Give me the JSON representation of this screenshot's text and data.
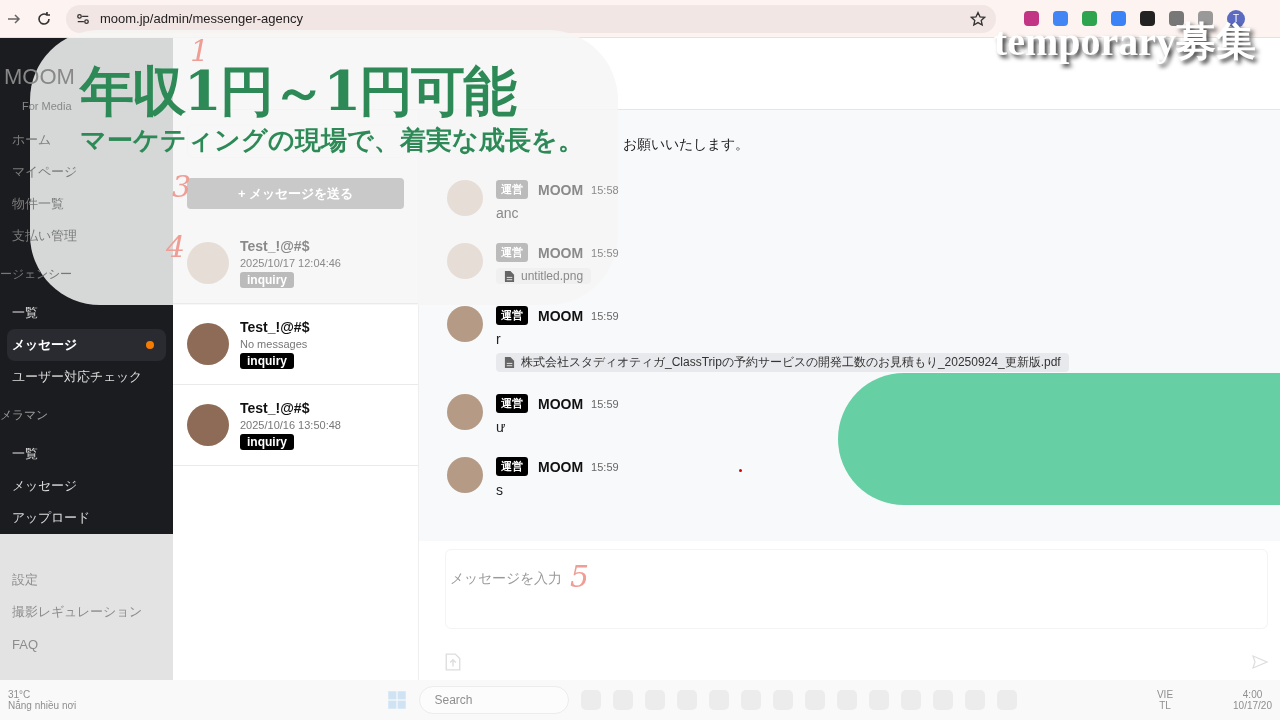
{
  "browser": {
    "url": "moom.jp/admin/messenger-agency",
    "profile": "T"
  },
  "sidebar": {
    "logo": "MOOM",
    "subtitle": "For Media",
    "sections": [
      {
        "faded": false,
        "items": [
          {
            "label": "ホーム",
            "selected": false,
            "dot": false
          },
          {
            "label": "マイページ",
            "selected": false,
            "dot": false
          },
          {
            "label": "物件一覧",
            "selected": false,
            "dot": false
          },
          {
            "label": "支払い管理",
            "selected": false,
            "dot": false
          }
        ]
      },
      {
        "title": "ージェンシー",
        "faded": false,
        "items": [
          {
            "label": "一覧",
            "selected": false,
            "dot": false
          },
          {
            "label": "メッセージ",
            "selected": true,
            "dot": true
          },
          {
            "label": "ユーザー対応チェック",
            "selected": false,
            "dot": false
          }
        ]
      },
      {
        "title": "メラマン",
        "faded": false,
        "items": [
          {
            "label": "一覧",
            "selected": false,
            "dot": false
          },
          {
            "label": "メッセージ",
            "selected": false,
            "dot": false
          },
          {
            "label": "アップロード",
            "selected": false,
            "dot": false
          }
        ]
      },
      {
        "faded": true,
        "items": [
          {
            "label": "設定",
            "selected": false,
            "dot": false
          },
          {
            "label": "撮影レギュレーション",
            "selected": false,
            "dot": false
          },
          {
            "label": "FAQ",
            "selected": false,
            "dot": false
          }
        ]
      }
    ]
  },
  "conversation_list": {
    "new_button": "+  メッセージを送る",
    "conversations": [
      {
        "name": "Test_!@#$",
        "subtitle": "2025/10/17 12:04:46",
        "tag": "inquiry"
      },
      {
        "name": "Test_!@#$",
        "subtitle": "No messages",
        "tag": "inquiry"
      },
      {
        "name": "Test_!@#$",
        "subtitle": "2025/10/16 13:50:48",
        "tag": "inquiry"
      }
    ]
  },
  "chat": {
    "intro": "お願いいたします。",
    "messages": [
      {
        "role": "運営",
        "sender": "MOOM",
        "time": "15:58",
        "text": "anc"
      },
      {
        "role": "運営",
        "sender": "MOOM",
        "time": "15:59",
        "attachments": [
          "untitled.png"
        ]
      },
      {
        "role": "運営",
        "sender": "MOOM",
        "time": "15:59",
        "text": "r",
        "attachments": [
          "株式会社スタディオティガ_ClassTripの予約サービスの開発工数のお見積もり_20250924_更新版.pdf"
        ]
      },
      {
        "role": "運営",
        "sender": "MOOM",
        "time": "15:59",
        "text": "ư"
      },
      {
        "role": "運営",
        "sender": "MOOM",
        "time": "15:59",
        "text": "s"
      }
    ],
    "input_placeholder": "メッセージを入力"
  },
  "annotations": [
    "1",
    "3",
    "4",
    "5"
  ],
  "promo": {
    "headline": "年収1円～1円可能",
    "tagline": "マーケティングの現場で、着実な成長を。",
    "badge": "temporary募集"
  },
  "taskbar": {
    "temperature": "31°C",
    "weather": "Nắng nhiều nơi",
    "search_placeholder": "Search",
    "language": "VIE",
    "layout": "TL",
    "time": "4:00",
    "date": "10/17/20"
  }
}
